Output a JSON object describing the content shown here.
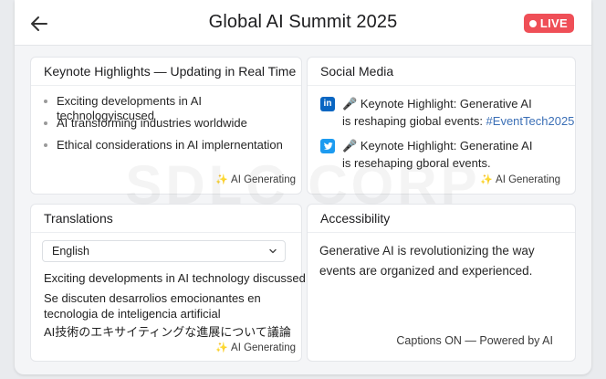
{
  "header": {
    "title": "Global AI Summit 2025",
    "live_label": "LIVE",
    "back_icon": "arrow-left-icon",
    "live_color": "#ef4f57"
  },
  "keynote": {
    "title": "Keynote Highlights — Updating in Real Time",
    "items": [
      "Exciting developments in AI technologyiscused",
      "AI transforming industries worldwide",
      "Ethical considerations in AI implernentation"
    ],
    "status": "AI Generating"
  },
  "social": {
    "title": "Social Media",
    "posts": [
      {
        "network": "LinkedIn",
        "logo": "linkedin-icon",
        "logo_text": "in",
        "color": "#0a66c2",
        "emoji": "🎤",
        "line1": "Keynote Highlight: Generative AI",
        "line2_text": "is reshaping giobal events: ",
        "hashtag": "#EventTech2025"
      },
      {
        "network": "Twitter",
        "logo": "twitter-icon",
        "logo_text": "🐦",
        "color": "#1d9bf0",
        "emoji": "🎤",
        "line1": "Keynote Highlight: Generatine AI",
        "line2_text": "is resehaping gboral events.",
        "hashtag": ""
      }
    ],
    "status": "AI Generating"
  },
  "translations": {
    "title": "Translations",
    "language": "English",
    "english": "Exciting developments in AI technology discussed",
    "spanish": "Se discuten desarrolios emocionantes en tecnologia de inteligencia artificial",
    "japanese": "AI技術のエキサイティングな進展について議論",
    "status": "AI Generating"
  },
  "accessibility": {
    "title": "Accessibility",
    "caption_text": "Generative AI is revolutionizing the way events are organized and experienced.",
    "footer": "Captions ON — Powered by AI"
  },
  "watermark": "SDLC CORP"
}
